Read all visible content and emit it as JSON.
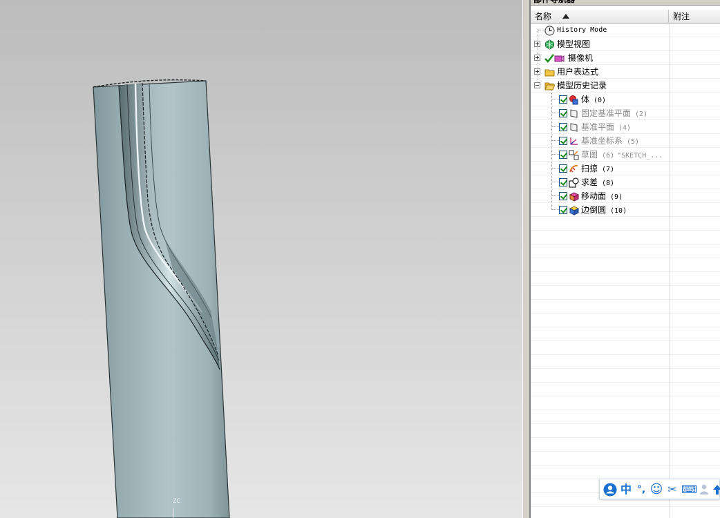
{
  "viewport": {
    "axis_label": "ZC"
  },
  "navigator": {
    "title": "部件导航器",
    "columns": {
      "name": "名称",
      "note": "附注"
    },
    "items": [
      {
        "label": "History Mode",
        "icon": "clock-icon"
      },
      {
        "label": "模型视图",
        "icon": "model-views-icon"
      },
      {
        "label": "摄像机",
        "icon": "camera-icon"
      },
      {
        "label": "用户表达式",
        "icon": "folder-icon"
      },
      {
        "label": "模型历史记录",
        "icon": "folder-open-icon"
      },
      {
        "label": "体",
        "num": "(0)",
        "icon": "body-icon"
      },
      {
        "label": "固定基准平面",
        "num": "(2)",
        "icon": "datum-plane-icon"
      },
      {
        "label": "基准平面",
        "num": "(4)",
        "icon": "datum-plane-icon"
      },
      {
        "label": "基准坐标系",
        "num": "(5)",
        "icon": "datum-csys-icon"
      },
      {
        "label": "草图",
        "num": "(6)",
        "extra": "\"SKETCH_...",
        "icon": "sketch-icon"
      },
      {
        "label": "扫掠",
        "num": "(7)",
        "icon": "sweep-icon"
      },
      {
        "label": "求差",
        "num": "(8)",
        "icon": "subtract-icon"
      },
      {
        "label": "移动面",
        "num": "(9)",
        "icon": "move-face-icon"
      },
      {
        "label": "边倒圆",
        "num": "(10)",
        "icon": "edge-blend-icon"
      }
    ]
  },
  "ime": {
    "mode_label": "中",
    "punct_label": "°,",
    "emoji": "☺",
    "scissors": "✂",
    "keyboard": "⌨"
  },
  "colors": {
    "check_green": "#1a8a1a",
    "model_surface": "#9fb3b8"
  }
}
